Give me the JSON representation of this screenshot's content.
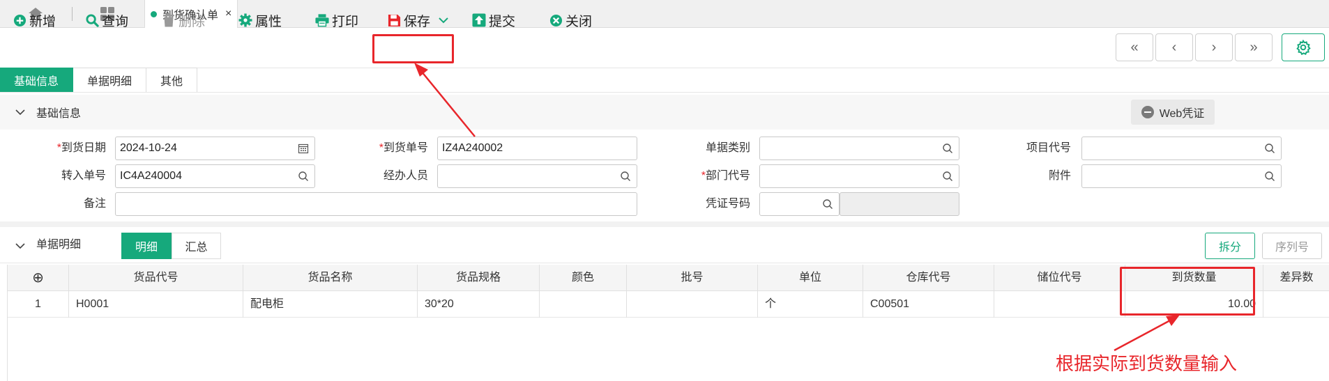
{
  "tabs": {
    "home_icon": "home-icon",
    "apps_icon": "grid-icon",
    "active_tab_label": "到货确认单",
    "close_glyph": "×"
  },
  "toolbar": {
    "add": "新增",
    "query": "查询",
    "delete": "删除",
    "properties": "属性",
    "print": "打印",
    "save": "保存",
    "submit": "提交",
    "close": "关闭"
  },
  "nav": {
    "first": "«",
    "prev": "‹",
    "next": "›",
    "last": "»"
  },
  "section_tabs": [
    "基础信息",
    "单据明细",
    "其他"
  ],
  "basic": {
    "title": "基础信息",
    "web_voucher": "Web凭证",
    "arrival_date_label": "到货日期",
    "arrival_date": "2024-10-24",
    "arrival_no_label": "到货单号",
    "arrival_no": "IZ4A240002",
    "doc_type_label": "单据类别",
    "doc_type": "",
    "project_code_label": "项目代号",
    "project_code": "",
    "transfer_no_label": "转入单号",
    "transfer_no": "IC4A240004",
    "handler_label": "经办人员",
    "handler": "",
    "dept_code_label": "部门代号",
    "dept_code": "",
    "attachment_label": "附件",
    "attachment": "",
    "remark_label": "备注",
    "remark": "",
    "voucher_no_label": "凭证号码",
    "voucher_no": "",
    "required_mark": "*"
  },
  "detail": {
    "title": "单据明细",
    "seg_detail": "明细",
    "seg_summary": "汇总",
    "split_button": "拆分",
    "serial_button": "序列号",
    "add_row_glyph": "⊕",
    "columns": [
      "货品代号",
      "货品名称",
      "货品规格",
      "颜色",
      "批号",
      "单位",
      "仓库代号",
      "储位代号",
      "到货数量",
      "差异数"
    ],
    "rows": [
      {
        "index": "1",
        "code": "H0001",
        "name": "配电柜",
        "spec": "30*20",
        "color": "",
        "batch": "",
        "unit": "个",
        "warehouse": "C00501",
        "location": "",
        "qty": "10.00",
        "diff": ""
      }
    ]
  },
  "annotation": {
    "text": "根据实际到货数量输入",
    "color": "#e8262b"
  },
  "colors": {
    "accent": "#16a97c",
    "annotation": "#e8262b"
  }
}
